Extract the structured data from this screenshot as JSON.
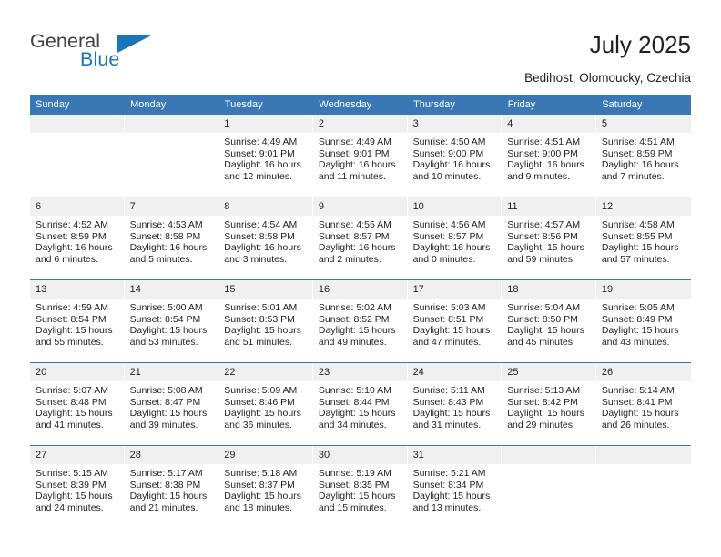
{
  "brand": {
    "name_dark": "General",
    "name_blue": "Blue",
    "accent_color": "#1b75bc"
  },
  "header": {
    "title": "July 2025",
    "subtitle": "Bedihost, Olomoucky, Czechia",
    "header_bg_color": "#3a78b5",
    "daynum_bg_color": "#f0f0f0"
  },
  "weekdays": [
    "Sunday",
    "Monday",
    "Tuesday",
    "Wednesday",
    "Thursday",
    "Friday",
    "Saturday"
  ],
  "weeks": [
    [
      {
        "day": "",
        "sunrise": "",
        "sunset": "",
        "daylight": "",
        "empty": true
      },
      {
        "day": "",
        "sunrise": "",
        "sunset": "",
        "daylight": "",
        "empty": true
      },
      {
        "day": "1",
        "sunrise": "Sunrise: 4:49 AM",
        "sunset": "Sunset: 9:01 PM",
        "daylight": "Daylight: 16 hours and 12 minutes."
      },
      {
        "day": "2",
        "sunrise": "Sunrise: 4:49 AM",
        "sunset": "Sunset: 9:01 PM",
        "daylight": "Daylight: 16 hours and 11 minutes."
      },
      {
        "day": "3",
        "sunrise": "Sunrise: 4:50 AM",
        "sunset": "Sunset: 9:00 PM",
        "daylight": "Daylight: 16 hours and 10 minutes."
      },
      {
        "day": "4",
        "sunrise": "Sunrise: 4:51 AM",
        "sunset": "Sunset: 9:00 PM",
        "daylight": "Daylight: 16 hours and 9 minutes."
      },
      {
        "day": "5",
        "sunrise": "Sunrise: 4:51 AM",
        "sunset": "Sunset: 8:59 PM",
        "daylight": "Daylight: 16 hours and 7 minutes."
      }
    ],
    [
      {
        "day": "6",
        "sunrise": "Sunrise: 4:52 AM",
        "sunset": "Sunset: 8:59 PM",
        "daylight": "Daylight: 16 hours and 6 minutes."
      },
      {
        "day": "7",
        "sunrise": "Sunrise: 4:53 AM",
        "sunset": "Sunset: 8:58 PM",
        "daylight": "Daylight: 16 hours and 5 minutes."
      },
      {
        "day": "8",
        "sunrise": "Sunrise: 4:54 AM",
        "sunset": "Sunset: 8:58 PM",
        "daylight": "Daylight: 16 hours and 3 minutes."
      },
      {
        "day": "9",
        "sunrise": "Sunrise: 4:55 AM",
        "sunset": "Sunset: 8:57 PM",
        "daylight": "Daylight: 16 hours and 2 minutes."
      },
      {
        "day": "10",
        "sunrise": "Sunrise: 4:56 AM",
        "sunset": "Sunset: 8:57 PM",
        "daylight": "Daylight: 16 hours and 0 minutes."
      },
      {
        "day": "11",
        "sunrise": "Sunrise: 4:57 AM",
        "sunset": "Sunset: 8:56 PM",
        "daylight": "Daylight: 15 hours and 59 minutes."
      },
      {
        "day": "12",
        "sunrise": "Sunrise: 4:58 AM",
        "sunset": "Sunset: 8:55 PM",
        "daylight": "Daylight: 15 hours and 57 minutes."
      }
    ],
    [
      {
        "day": "13",
        "sunrise": "Sunrise: 4:59 AM",
        "sunset": "Sunset: 8:54 PM",
        "daylight": "Daylight: 15 hours and 55 minutes."
      },
      {
        "day": "14",
        "sunrise": "Sunrise: 5:00 AM",
        "sunset": "Sunset: 8:54 PM",
        "daylight": "Daylight: 15 hours and 53 minutes."
      },
      {
        "day": "15",
        "sunrise": "Sunrise: 5:01 AM",
        "sunset": "Sunset: 8:53 PM",
        "daylight": "Daylight: 15 hours and 51 minutes."
      },
      {
        "day": "16",
        "sunrise": "Sunrise: 5:02 AM",
        "sunset": "Sunset: 8:52 PM",
        "daylight": "Daylight: 15 hours and 49 minutes."
      },
      {
        "day": "17",
        "sunrise": "Sunrise: 5:03 AM",
        "sunset": "Sunset: 8:51 PM",
        "daylight": "Daylight: 15 hours and 47 minutes."
      },
      {
        "day": "18",
        "sunrise": "Sunrise: 5:04 AM",
        "sunset": "Sunset: 8:50 PM",
        "daylight": "Daylight: 15 hours and 45 minutes."
      },
      {
        "day": "19",
        "sunrise": "Sunrise: 5:05 AM",
        "sunset": "Sunset: 8:49 PM",
        "daylight": "Daylight: 15 hours and 43 minutes."
      }
    ],
    [
      {
        "day": "20",
        "sunrise": "Sunrise: 5:07 AM",
        "sunset": "Sunset: 8:48 PM",
        "daylight": "Daylight: 15 hours and 41 minutes."
      },
      {
        "day": "21",
        "sunrise": "Sunrise: 5:08 AM",
        "sunset": "Sunset: 8:47 PM",
        "daylight": "Daylight: 15 hours and 39 minutes."
      },
      {
        "day": "22",
        "sunrise": "Sunrise: 5:09 AM",
        "sunset": "Sunset: 8:46 PM",
        "daylight": "Daylight: 15 hours and 36 minutes."
      },
      {
        "day": "23",
        "sunrise": "Sunrise: 5:10 AM",
        "sunset": "Sunset: 8:44 PM",
        "daylight": "Daylight: 15 hours and 34 minutes."
      },
      {
        "day": "24",
        "sunrise": "Sunrise: 5:11 AM",
        "sunset": "Sunset: 8:43 PM",
        "daylight": "Daylight: 15 hours and 31 minutes."
      },
      {
        "day": "25",
        "sunrise": "Sunrise: 5:13 AM",
        "sunset": "Sunset: 8:42 PM",
        "daylight": "Daylight: 15 hours and 29 minutes."
      },
      {
        "day": "26",
        "sunrise": "Sunrise: 5:14 AM",
        "sunset": "Sunset: 8:41 PM",
        "daylight": "Daylight: 15 hours and 26 minutes."
      }
    ],
    [
      {
        "day": "27",
        "sunrise": "Sunrise: 5:15 AM",
        "sunset": "Sunset: 8:39 PM",
        "daylight": "Daylight: 15 hours and 24 minutes."
      },
      {
        "day": "28",
        "sunrise": "Sunrise: 5:17 AM",
        "sunset": "Sunset: 8:38 PM",
        "daylight": "Daylight: 15 hours and 21 minutes."
      },
      {
        "day": "29",
        "sunrise": "Sunrise: 5:18 AM",
        "sunset": "Sunset: 8:37 PM",
        "daylight": "Daylight: 15 hours and 18 minutes."
      },
      {
        "day": "30",
        "sunrise": "Sunrise: 5:19 AM",
        "sunset": "Sunset: 8:35 PM",
        "daylight": "Daylight: 15 hours and 15 minutes."
      },
      {
        "day": "31",
        "sunrise": "Sunrise: 5:21 AM",
        "sunset": "Sunset: 8:34 PM",
        "daylight": "Daylight: 15 hours and 13 minutes."
      },
      {
        "day": "",
        "sunrise": "",
        "sunset": "",
        "daylight": "",
        "empty": true
      },
      {
        "day": "",
        "sunrise": "",
        "sunset": "",
        "daylight": "",
        "empty": true
      }
    ]
  ]
}
